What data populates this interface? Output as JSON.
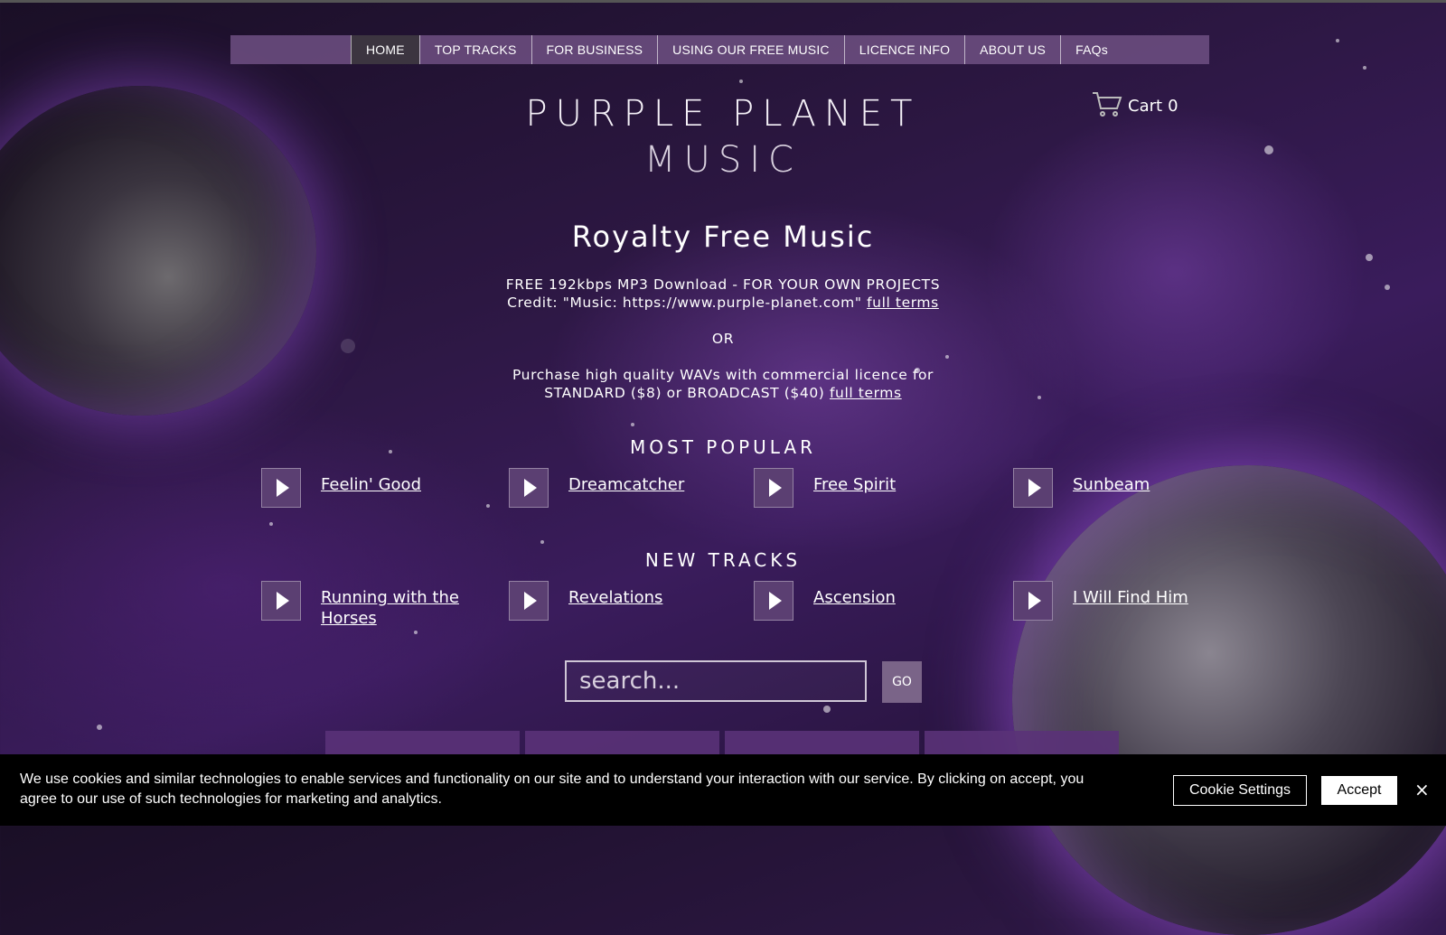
{
  "nav": {
    "items": [
      {
        "label": "HOME",
        "active": true
      },
      {
        "label": "TOP TRACKS"
      },
      {
        "label": "FOR BUSINESS"
      },
      {
        "label": "USING OUR FREE MUSIC"
      },
      {
        "label": "LICENCE INFO"
      },
      {
        "label": "ABOUT US"
      },
      {
        "label": "FAQs"
      }
    ]
  },
  "cart": {
    "label": "Cart",
    "count": "0",
    "icon": "cart-icon"
  },
  "logo": {
    "line1": "PURPLE PLANET",
    "line2": "MUSIC"
  },
  "hero": {
    "title": "Royalty Free Music",
    "free_line": "FREE 192kbps MP3 Download - FOR YOUR OWN PROJECTS",
    "credit_line": "Credit: \"Music: https://www.purple-planet.com\"",
    "full_terms": "full terms",
    "or": "OR",
    "purchase_line": "Purchase high quality WAVs with commercial licence for",
    "pricing_line": "STANDARD ($8) or BROADCAST ($40)",
    "full_terms2": "full terms"
  },
  "most_popular": {
    "heading": "MOST POPULAR",
    "tracks": [
      "Feelin' Good",
      "Dreamcatcher",
      "Free Spirit",
      "Sunbeam"
    ]
  },
  "new_tracks": {
    "heading": "NEW TRACKS",
    "tracks": [
      "Running with the Horses",
      "Revelations",
      "Ascension",
      "I Will Find Him"
    ]
  },
  "search": {
    "placeholder": "search...",
    "go_label": "GO"
  },
  "cookie": {
    "text": "We use cookies and similar technologies to enable services and functionality on our site and to understand your interaction with our service. By clicking on accept, you agree to our use of such technologies for marketing and analytics.",
    "settings_label": "Cookie Settings",
    "accept_label": "Accept",
    "close_label": "×"
  },
  "colors": {
    "accent": "#5b3f72",
    "nav_bg": "#6e5082",
    "nav_active": "#3c3540"
  }
}
